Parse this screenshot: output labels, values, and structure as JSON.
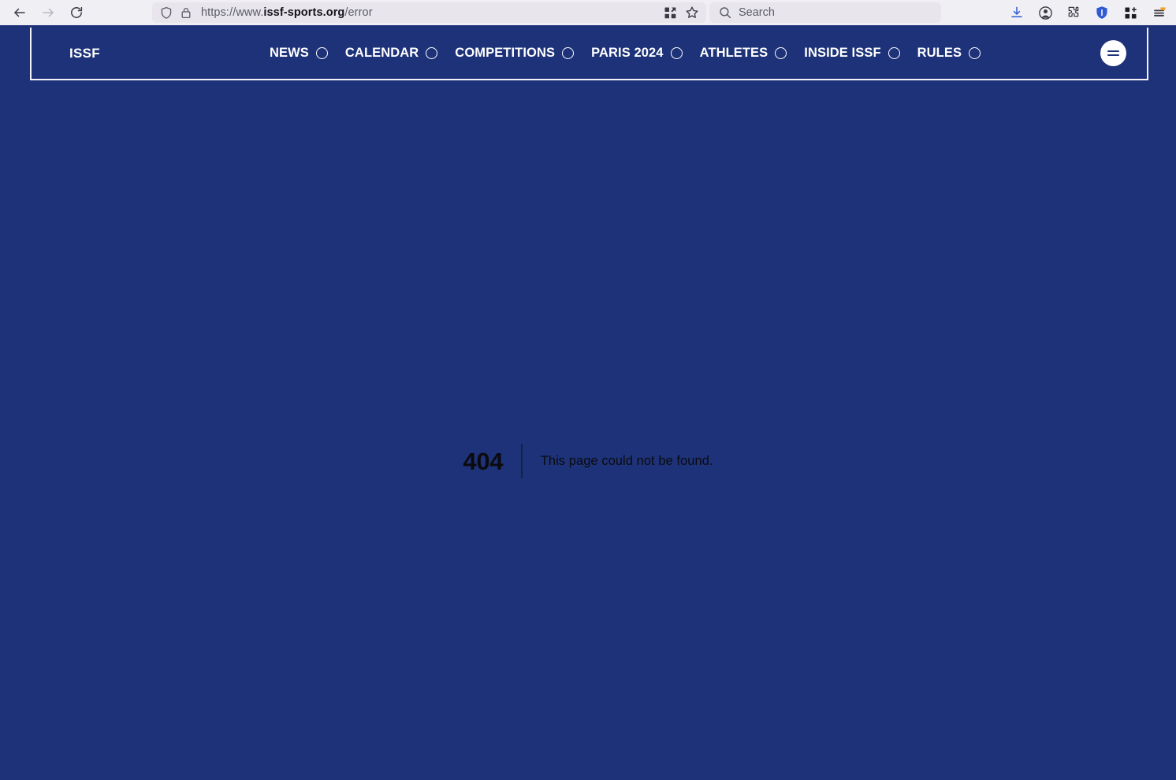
{
  "browser": {
    "back_label": "Back",
    "forward_label": "Forward",
    "reload_label": "Reload",
    "url": {
      "scheme_prefix": "https://www.",
      "host": "issf-sports.org",
      "path": "/error",
      "full": "https://www.issf-sports.org/error"
    },
    "shield_icon": "shield-icon",
    "lock_icon": "lock-icon",
    "page_actions": [
      {
        "icon": "open-in-app-icon",
        "label": "Open in app"
      },
      {
        "icon": "bookmark-star-icon",
        "label": "Bookmark this page"
      }
    ],
    "search": {
      "placeholder": "Search",
      "icon": "search-icon"
    },
    "toolbar_icons": [
      {
        "icon": "download-icon",
        "label": "Downloads"
      },
      {
        "icon": "account-icon",
        "label": "Account"
      },
      {
        "icon": "extensions-puzzle-icon",
        "label": "Extensions"
      },
      {
        "icon": "shield-badge-icon",
        "label": "Privacy shield"
      },
      {
        "icon": "apps-grid-icon",
        "label": "Apps"
      },
      {
        "icon": "app-menu-icon",
        "label": "Open application menu",
        "badge": "update-available"
      }
    ],
    "chrome_bg": "#f0eff4",
    "field_bg": "#e8e6ec"
  },
  "site": {
    "brand": "ISSF",
    "brand_color": "#ffffff",
    "background_color": "#1d3278",
    "border_color": "#f4f3f7",
    "nav_items": [
      {
        "label": "NEWS",
        "icon": "circle-outline-icon"
      },
      {
        "label": "CALENDAR",
        "icon": "circle-outline-icon"
      },
      {
        "label": "COMPETITIONS",
        "icon": "circle-outline-icon"
      },
      {
        "label": "PARIS 2024",
        "icon": "circle-outline-icon"
      },
      {
        "label": "ATHLETES",
        "icon": "circle-outline-icon"
      },
      {
        "label": "INSIDE ISSF",
        "icon": "circle-outline-icon"
      },
      {
        "label": "RULES",
        "icon": "circle-outline-icon"
      }
    ],
    "menu_toggle": {
      "label": "Menu",
      "icon": "hamburger-icon"
    }
  },
  "error": {
    "code": "404",
    "message": "This page could not be found."
  }
}
